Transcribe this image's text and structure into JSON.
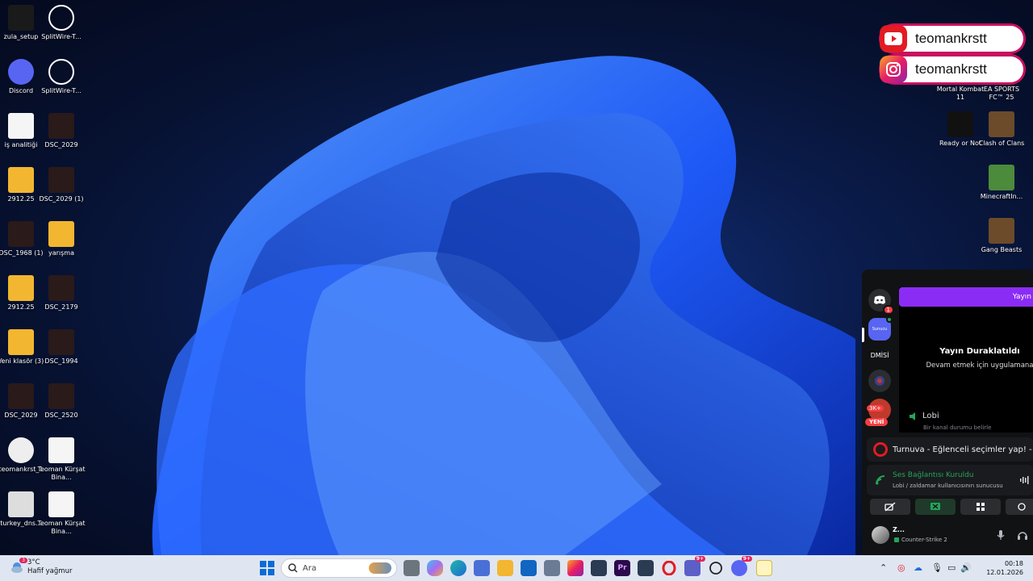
{
  "desktop": {
    "icons_left": [
      {
        "label": "zula_setup",
        "icon": "zula-icon"
      },
      {
        "label": "SplitWire-T...",
        "icon": "splitwire-icon"
      },
      {
        "label": "Discord",
        "icon": "discord-icon"
      },
      {
        "label": "SplitWire-T...",
        "icon": "splitwire-icon"
      },
      {
        "label": "iş analitiği",
        "icon": "document-icon"
      },
      {
        "label": "DSC_2029",
        "icon": "photo-icon"
      },
      {
        "label": "2912.25",
        "icon": "folder-icon"
      },
      {
        "label": "DSC_2029 (1)",
        "icon": "photo-icon"
      },
      {
        "label": "DSC_1968 (1)",
        "icon": "photo-icon"
      },
      {
        "label": "yarışma",
        "icon": "folder-icon"
      },
      {
        "label": "2912.25",
        "icon": "folder-icon"
      },
      {
        "label": "DSC_2179",
        "icon": "photo-icon"
      },
      {
        "label": "Yeni klasör (3)",
        "icon": "folder-icon"
      },
      {
        "label": "DSC_1994",
        "icon": "photo-icon"
      },
      {
        "label": "DSC_2029",
        "icon": "photo-icon"
      },
      {
        "label": "DSC_2520",
        "icon": "photo-icon"
      },
      {
        "label": "teomankrst_1",
        "icon": "video-icon"
      },
      {
        "label": "Teoman Kürşat Bina...",
        "icon": "document-icon"
      },
      {
        "label": "turkey_dns...",
        "icon": "settings-file-icon"
      },
      {
        "label": "Teoman Kürşat Bina...",
        "icon": "document-icon"
      }
    ],
    "icons_right": [
      {
        "label": "Mortal Kombat 11",
        "icon": "game-icon"
      },
      {
        "label": "EA SPORTS FC™ 25",
        "icon": "game-icon"
      },
      {
        "label": "Ready or Not",
        "icon": "epic-games-icon"
      },
      {
        "label": "Clash of Clans",
        "icon": "game-icon"
      },
      {
        "label": "MinecraftIn...",
        "icon": "minecraft-icon"
      },
      {
        "label": "Gang Beasts",
        "icon": "game-icon"
      }
    ]
  },
  "social": {
    "youtube_handle": "teomankrstt",
    "instagram_handle": "teomankrstt"
  },
  "overlay": {
    "stream_bar_label": "Yayın",
    "paused_title": "Yayın Duraklatıldı",
    "paused_sub": "Devam etmek için uygulamana",
    "dm_label": "DMİSİ",
    "badge_count": "1",
    "badge_3k": "3K+",
    "badge_new": "YENİ",
    "channel_name": "Lobi",
    "channel_status": "Bir kanal durumu belirle",
    "event_text": "Turnuva - Eğlenceli seçimler yap! - ...",
    "voice_title": "Ses Bağlantısı Kuruldu",
    "voice_sub": "Lobi / zaldamar kullanıcısının sunucusu",
    "user_name": "Z...",
    "user_activity": "Counter-Strike 2"
  },
  "taskbar": {
    "temperature": "3°C",
    "weather_desc": "Hafif yağmur",
    "search_placeholder": "Ara",
    "time": "00:18",
    "date": "12.01.2026",
    "teams_badge": "9+",
    "discord_badge": "9+",
    "weather_badge": "3"
  }
}
